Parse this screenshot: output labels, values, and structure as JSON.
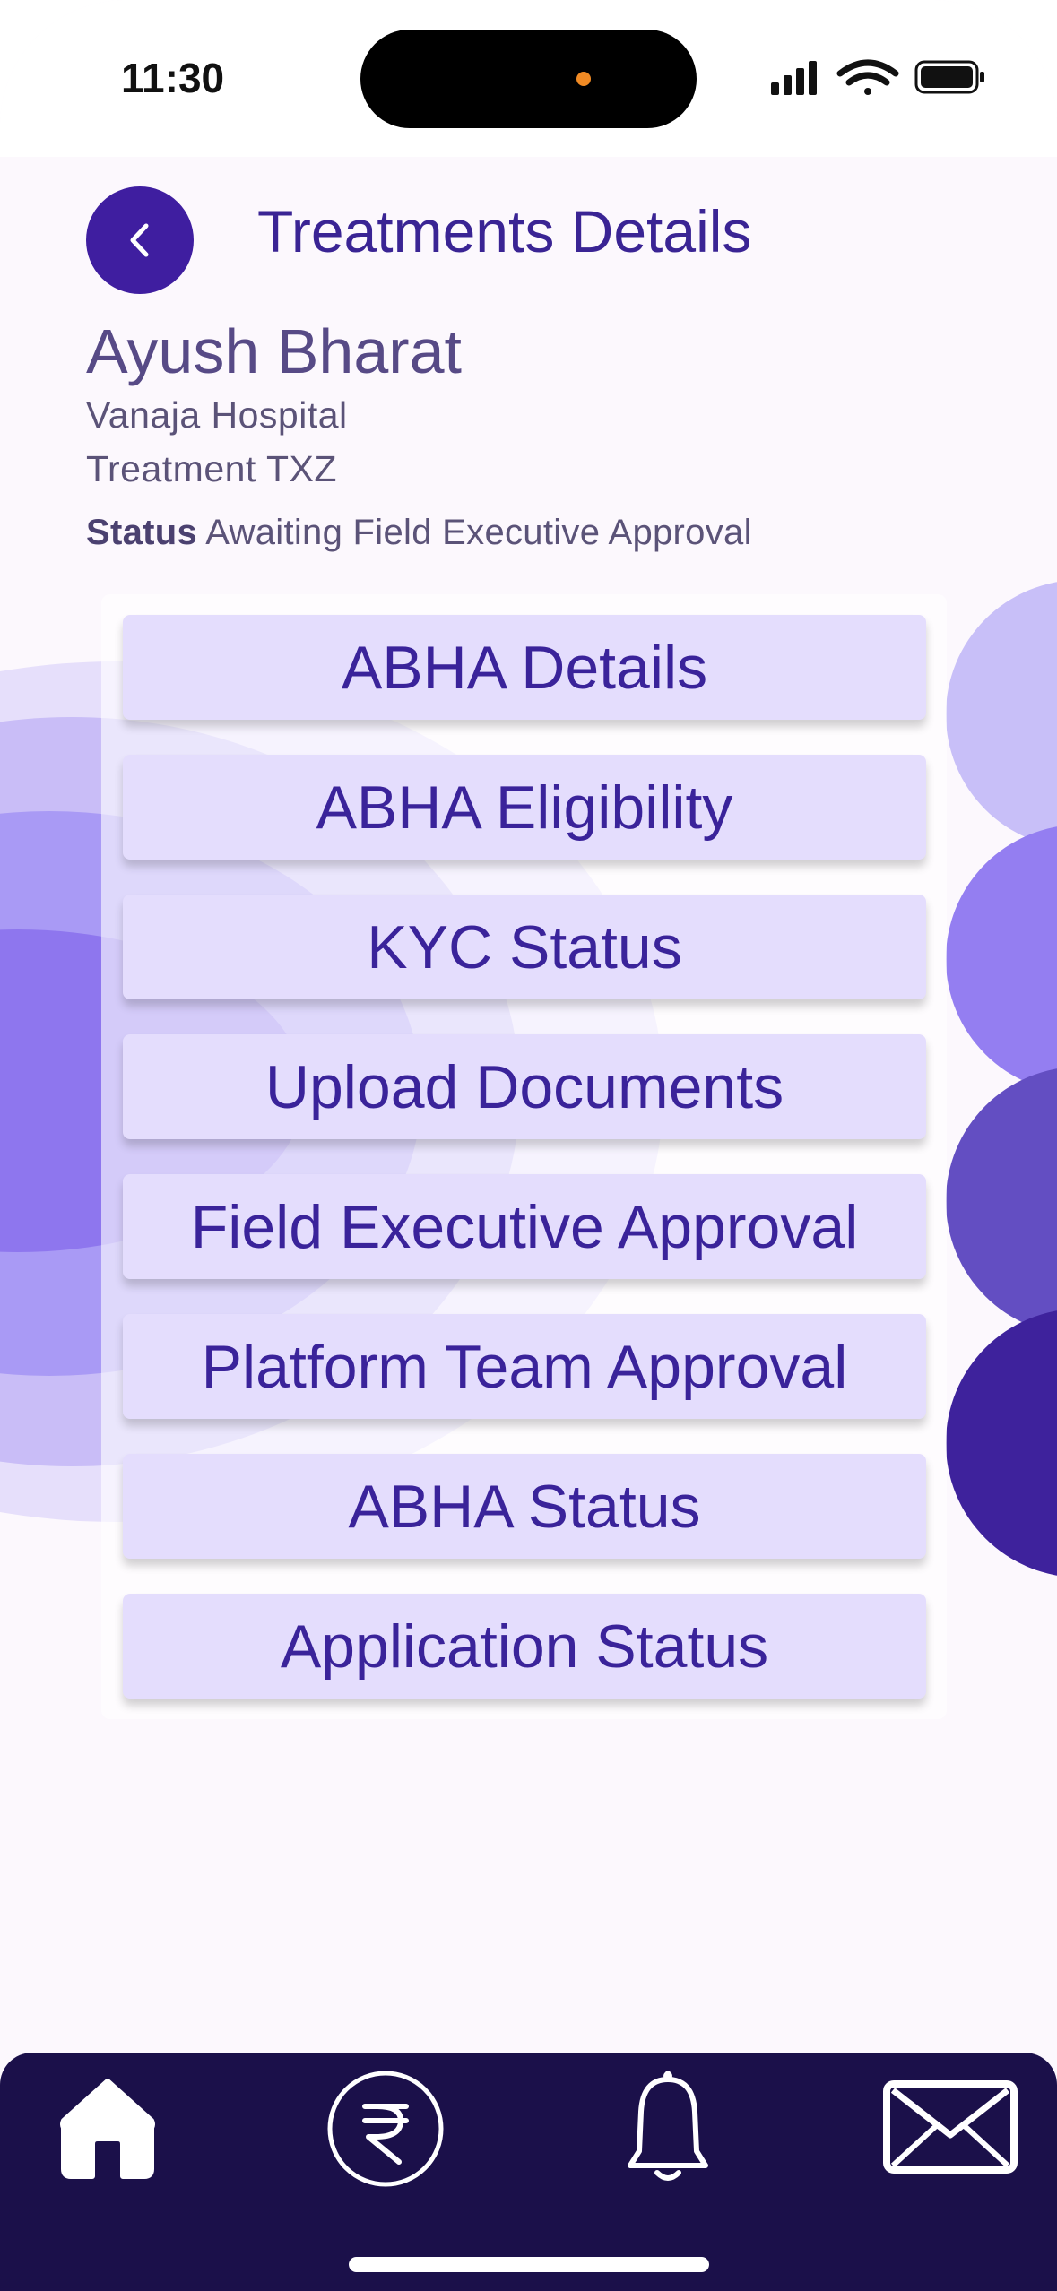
{
  "status_bar": {
    "time": "11:30"
  },
  "header": {
    "title": "Treatments Details"
  },
  "patient": {
    "name": "Ayush Bharat",
    "hospital": "Vanaja Hospital",
    "treatment": "Treatment TXZ",
    "status_label": "Status",
    "status_value": "Awaiting Field Executive Approval"
  },
  "menu": [
    {
      "label": "ABHA Details"
    },
    {
      "label": "ABHA Eligibility"
    },
    {
      "label": "KYC Status"
    },
    {
      "label": "Upload Documents"
    },
    {
      "label": "Field Executive Approval"
    },
    {
      "label": "Platform Team Approval"
    },
    {
      "label": "ABHA Status"
    },
    {
      "label": "Application Status"
    }
  ],
  "bottom_nav": {
    "items": [
      {
        "icon": "home-icon"
      },
      {
        "icon": "rupee-icon"
      },
      {
        "icon": "bell-icon"
      },
      {
        "icon": "mail-icon"
      }
    ]
  },
  "colors": {
    "primary": "#3f1ea0",
    "title_text": "#3a2494",
    "button_bg": "#e4ddfd",
    "nav_bg": "#1b104a",
    "page_bg": "#fcf8fd"
  }
}
